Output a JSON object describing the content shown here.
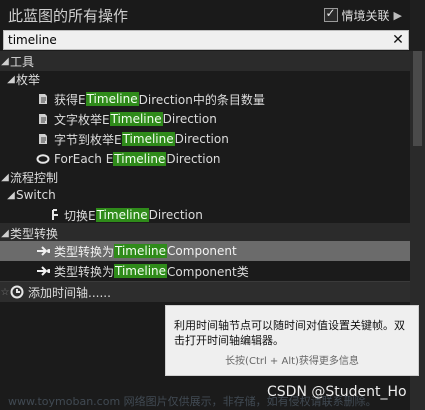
{
  "header": {
    "title": "此蓝图的所有操作",
    "context_label": "情境关联",
    "context_checked": true
  },
  "search": {
    "value": "timeline"
  },
  "tree": {
    "cat_tools": "工具",
    "cat_enum": "枚举",
    "enum_items": [
      {
        "prefix": "获得E",
        "hl": "Timeline",
        "suffix": "Direction中的条目数量"
      },
      {
        "prefix": "文字枚举E",
        "hl": "Timeline",
        "suffix": "Direction"
      },
      {
        "prefix": "字节到枚举E",
        "hl": "Timeline",
        "suffix": "Direction"
      },
      {
        "prefix": "ForEach E",
        "hl": "Timeline",
        "suffix": "Direction"
      }
    ],
    "cat_flow": "流程控制",
    "cat_switch": "Switch",
    "switch_item": {
      "prefix": "切换E",
      "hl": "Timeline",
      "suffix": "Direction"
    },
    "cat_cast": "类型转换",
    "cast_items": [
      {
        "prefix": "类型转换为 ",
        "hl": "Timeline",
        "suffix": "Component"
      },
      {
        "prefix": "类型转换为 ",
        "hl": "Timeline",
        "suffix": "Component类"
      }
    ],
    "add_timeline": "添加时间轴......"
  },
  "tooltip": {
    "main": "利用时间轴节点可以随时间对值设置关键帧。双击打开时间轴编辑器。",
    "sub": "长按(Ctrl + Alt)获得更多信息"
  },
  "watermark": "www.toymoban.com 网络图片仅供展示，非存储，如有侵权请联系删除。",
  "csdn": "CSDN @Student_Ho"
}
